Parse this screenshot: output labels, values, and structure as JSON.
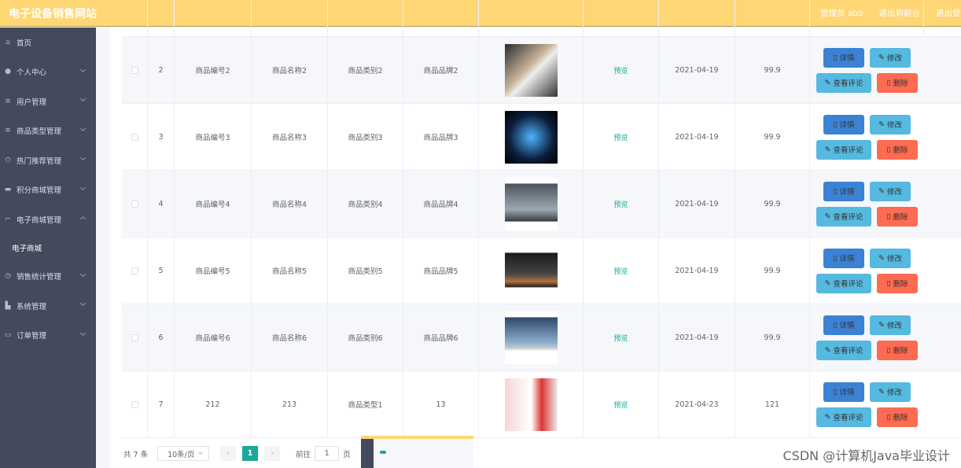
{
  "header": {
    "title": "电子设备销售网站",
    "links": [
      "管理员 abo",
      "退出到前台",
      "退出登录"
    ]
  },
  "sidebar": {
    "items": [
      {
        "label": "首页",
        "icon": "home-icon",
        "chev": ""
      },
      {
        "label": "个人中心",
        "icon": "user-icon",
        "chev": "down"
      },
      {
        "label": "用户管理",
        "icon": "list-icon",
        "chev": "down"
      },
      {
        "label": "商品类型管理",
        "icon": "list-icon",
        "chev": "down"
      },
      {
        "label": "热门推荐管理",
        "icon": "power-icon",
        "chev": "down"
      },
      {
        "label": "积分商城管理",
        "icon": "monitor-icon",
        "chev": "down"
      },
      {
        "label": "电子商城管理",
        "icon": "crop-icon",
        "chev": "up",
        "sub": "电子商城"
      },
      {
        "label": "销售统计管理",
        "icon": "compass-icon",
        "chev": "down"
      },
      {
        "label": "系统管理",
        "icon": "camera-icon",
        "chev": "down"
      },
      {
        "label": "订单管理",
        "icon": "message-icon",
        "chev": "down"
      }
    ]
  },
  "table": {
    "preview_label": "预览",
    "buttons": {
      "detail": "详情",
      "edit": "修改",
      "comment": "查看评论",
      "delete": "删除"
    },
    "rows": [
      {
        "idx": "2",
        "code": "商品编号2",
        "name": "商品名称2",
        "type": "商品类别2",
        "brand": "商品品牌2",
        "image": "watch",
        "date": "2021-04-19",
        "price": "99.9"
      },
      {
        "idx": "3",
        "code": "商品编号3",
        "name": "商品名称3",
        "type": "商品类别3",
        "brand": "商品品牌3",
        "image": "pc-case",
        "date": "2021-04-19",
        "price": "99.9"
      },
      {
        "idx": "4",
        "code": "商品编号4",
        "name": "商品名称4",
        "type": "商品类别4",
        "brand": "商品品牌4",
        "image": "monitor",
        "date": "2021-04-19",
        "price": "99.9"
      },
      {
        "idx": "5",
        "code": "商品编号5",
        "name": "商品名称5",
        "type": "商品类别5",
        "brand": "商品品牌5",
        "image": "audio-mixer",
        "date": "2021-04-19",
        "price": "99.9"
      },
      {
        "idx": "6",
        "code": "商品编号6",
        "name": "商品名称6",
        "type": "商品类别6",
        "brand": "商品品牌6",
        "image": "laptop",
        "date": "2021-04-19",
        "price": "99.9"
      },
      {
        "idx": "7",
        "code": "212",
        "name": "213",
        "type": "商品类型1",
        "brand": "13",
        "image": "poster",
        "date": "2021-04-23",
        "price": "121"
      }
    ]
  },
  "pager": {
    "total": "共 7 条",
    "page_size": "10条/页",
    "current": "1",
    "goto_label": "前往",
    "goto_value": "1",
    "page_unit": "页",
    "prev": "‹",
    "next": "›"
  },
  "watermark": "CSDN @计算机Java毕业设计"
}
